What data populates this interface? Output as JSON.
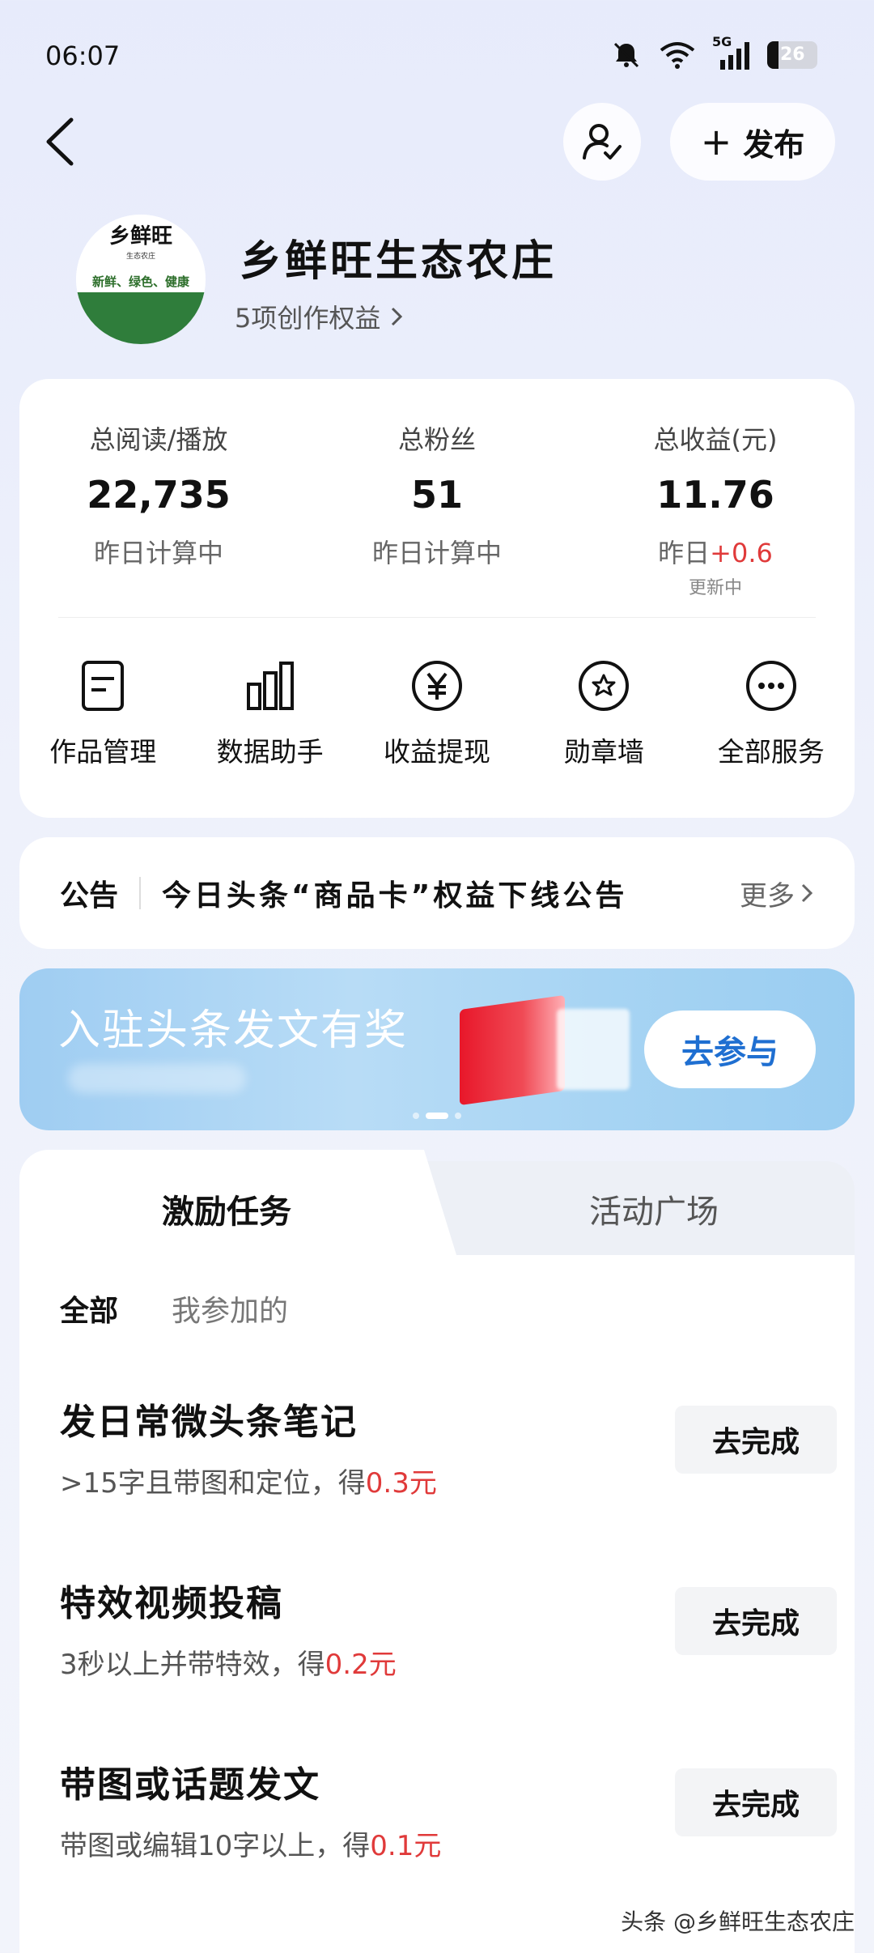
{
  "status": {
    "time": "06:07",
    "network": "5G",
    "battery": "26"
  },
  "header": {
    "publish_label": "发布"
  },
  "profile": {
    "avatar_name": "乡鲜旺",
    "avatar_sub": "生态农庄",
    "avatar_slogan": "新鲜、绿色、健康",
    "name": "乡鲜旺生态农庄",
    "benefit": "5项创作权益"
  },
  "stats": [
    {
      "label": "总阅读/播放",
      "value": "22,735",
      "sub": "昨日计算中"
    },
    {
      "label": "总粉丝",
      "value": "51",
      "sub": "昨日计算中"
    },
    {
      "label": "总收益(元)",
      "value": "11.76",
      "sub_prefix": "昨日",
      "sub_delta": "+0.6",
      "sub_note": "更新中"
    }
  ],
  "tools": [
    {
      "label": "作品管理",
      "icon": "document-icon"
    },
    {
      "label": "数据助手",
      "icon": "bar-chart-icon"
    },
    {
      "label": "收益提现",
      "icon": "yuan-icon"
    },
    {
      "label": "勋章墙",
      "icon": "medal-icon"
    },
    {
      "label": "全部服务",
      "icon": "more-icon"
    }
  ],
  "notice": {
    "label": "公告",
    "text": "今日头条“商品卡”权益下线公告",
    "more": "更多"
  },
  "banner": {
    "title": "入驻头条发文有奖",
    "button": "去参与"
  },
  "tasks": {
    "tabs": [
      "激励任务",
      "活动广场"
    ],
    "filters": [
      "全部",
      "我参加的"
    ],
    "items": [
      {
        "title": "发日常微头条笔记",
        "desc": ">15字且带图和定位，得",
        "reward": "0.3元",
        "button": "去完成"
      },
      {
        "title": "特效视频投稿",
        "desc": "3秒以上并带特效，得",
        "reward": "0.2元",
        "button": "去完成"
      },
      {
        "title": "带图或话题发文",
        "desc": "带图或编辑10字以上，得",
        "reward": "0.1元",
        "button": "去完成"
      }
    ]
  },
  "watermark": "头条 @乡鲜旺生态农庄",
  "colors": {
    "accent_red": "#e03a3a",
    "banner_button_blue": "#1f6fd1"
  }
}
